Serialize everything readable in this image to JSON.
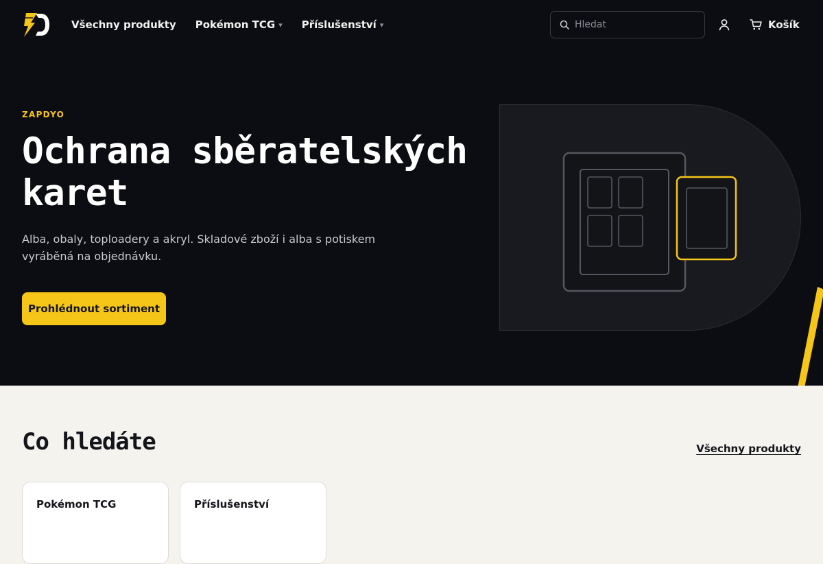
{
  "header": {
    "logo": "brand-logo",
    "nav": [
      {
        "label": "Všechny produkty",
        "has_dropdown": false
      },
      {
        "label": "Pokémon TCG",
        "has_dropdown": true
      },
      {
        "label": "Příslušenství",
        "has_dropdown": true
      }
    ],
    "dropdown_caret": "▾",
    "search": {
      "placeholder": "Hledat",
      "icon": "search-icon"
    },
    "account_icon": "user-icon",
    "cart": {
      "label": "Košík",
      "icon": "cart-icon"
    }
  },
  "hero": {
    "eyebrow": "ZAPDYO",
    "title": "Ochrana sběratelských karet",
    "subtitle": "Alba, obaly, toploadery a akryl. Skladové zboží i alba s potiskem vyráběná na objednávku.",
    "cta_label": "Prohlédnout sortiment"
  },
  "categories": {
    "title": "Co hledáte",
    "all_link": "Všechny produkty",
    "items": [
      {
        "label": "Pokémon TCG"
      },
      {
        "label": "Příslušenství"
      }
    ]
  },
  "colors": {
    "dark_bg": "#0c0d12",
    "accent": "#f5c518",
    "light_bg": "#f4f3ee"
  }
}
